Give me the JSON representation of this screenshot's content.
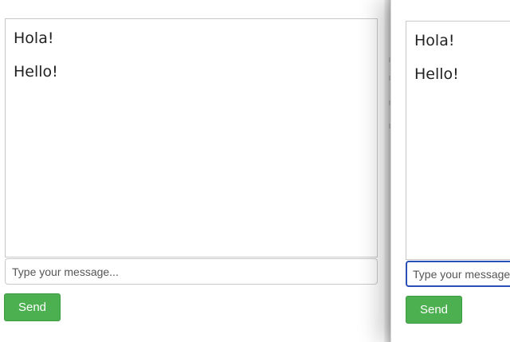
{
  "chat_left": {
    "messages": [
      "Hola!",
      "Hello!"
    ],
    "input": {
      "placeholder": "Type your message...",
      "value": ""
    },
    "send_label": "Send"
  },
  "chat_right": {
    "messages": [
      "Hola!",
      "Hello!"
    ],
    "input": {
      "placeholder": "Type your message...",
      "value": ""
    },
    "send_label": "Send"
  },
  "colors": {
    "send_button": "#4caf50",
    "focused_input_border": "#2a4fb7"
  }
}
